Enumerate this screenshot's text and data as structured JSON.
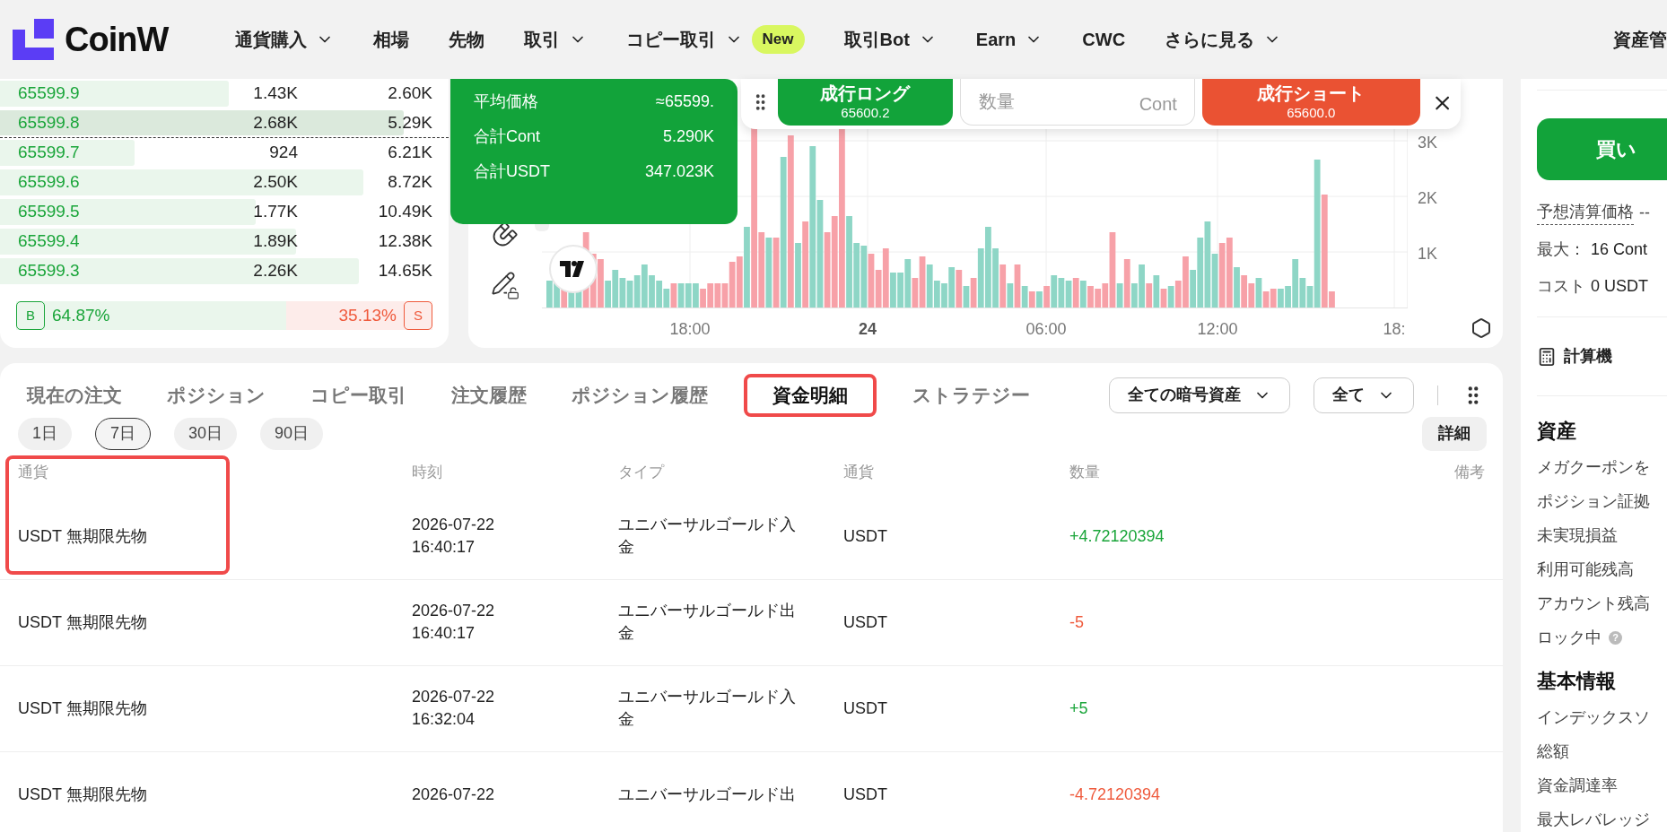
{
  "header": {
    "logo": "CoinW",
    "nav": [
      {
        "label": "通貨購入",
        "dropdown": true
      },
      {
        "label": "相場",
        "dropdown": false
      },
      {
        "label": "先物",
        "dropdown": false
      },
      {
        "label": "取引",
        "dropdown": true
      },
      {
        "label": "コピー取引",
        "dropdown": true,
        "badge": "New"
      },
      {
        "label": "取引Bot",
        "dropdown": true
      },
      {
        "label": "Earn",
        "dropdown": true
      },
      {
        "label": "CWC",
        "dropdown": false
      },
      {
        "label": "さらに見る",
        "dropdown": true
      }
    ],
    "account": "資産管"
  },
  "order_book": {
    "rows": [
      {
        "price": "65599.9",
        "size": "1.43K",
        "total": "2.60K",
        "level": 0.51,
        "selected": false
      },
      {
        "price": "65599.8",
        "size": "2.68K",
        "total": "5.29K",
        "level": 0.9,
        "selected": true
      },
      {
        "price": "65599.7",
        "size": "924",
        "total": "6.21K",
        "level": 0.3,
        "selected": false
      },
      {
        "price": "65599.6",
        "size": "2.50K",
        "total": "8.72K",
        "level": 0.81,
        "selected": false
      },
      {
        "price": "65599.5",
        "size": "1.77K",
        "total": "10.49K",
        "level": 0.57,
        "selected": false
      },
      {
        "price": "65599.4",
        "size": "1.89K",
        "total": "12.38K",
        "level": 0.66,
        "selected": false
      },
      {
        "price": "65599.3",
        "size": "2.26K",
        "total": "14.65K",
        "level": 0.8,
        "selected": false
      }
    ],
    "buy_ratio": {
      "badge": "B",
      "text": "64.87%",
      "level": 0.6487
    },
    "sell_ratio": {
      "badge": "S",
      "text": "35.13%"
    }
  },
  "price_tooltip": {
    "rows": [
      {
        "label": "平均価格",
        "value": "≈65599."
      },
      {
        "label": "合計Cont",
        "value": "5.290K"
      },
      {
        "label": "合計USDT",
        "value": "347.023K"
      }
    ]
  },
  "quick_trade": {
    "long": {
      "label": "成行ロング",
      "price": "65600.2"
    },
    "quantity": {
      "placeholder": "数量",
      "unit": "Cont"
    },
    "short": {
      "label": "成行ショート",
      "price": "65600.0"
    }
  },
  "chart": {
    "y_labels": [
      "3K",
      "2K",
      "1K"
    ],
    "x_labels": [
      {
        "label": "18:00",
        "bold": false
      },
      {
        "label": "24",
        "bold": true
      },
      {
        "label": "06:00",
        "bold": false
      },
      {
        "label": "12:00",
        "bold": false
      },
      {
        "label": "18:",
        "bold": false
      }
    ]
  },
  "bottom": {
    "tabs": [
      {
        "label": "現在の注文",
        "selected": false,
        "annotated": false
      },
      {
        "label": "ポジション",
        "selected": false,
        "annotated": false
      },
      {
        "label": "コピー取引",
        "selected": false,
        "annotated": false
      },
      {
        "label": "注文履歴",
        "selected": false,
        "annotated": false
      },
      {
        "label": "ポジション履歴",
        "selected": false,
        "annotated": false
      },
      {
        "label": "資金明細",
        "selected": true,
        "annotated": true
      },
      {
        "label": "ストラテジー",
        "selected": false,
        "annotated": false
      }
    ],
    "filters": [
      "全ての暗号資産",
      "全て"
    ],
    "periods": [
      {
        "label": "1日",
        "selected": false
      },
      {
        "label": "7日",
        "selected": true
      },
      {
        "label": "30日",
        "selected": false
      },
      {
        "label": "90日",
        "selected": false
      }
    ],
    "detail_button": "詳細",
    "table": {
      "columns": [
        "通貨",
        "時刻",
        "タイプ",
        "通貨",
        "数量",
        "備考"
      ],
      "annotated": true,
      "rows": [
        {
          "account": "USDT 無期限先物",
          "date": "2026-07-22",
          "time": "16:40:17",
          "type": "ユニバーサルゴールド入金",
          "currency": "USDT",
          "amount": "+4.72120394",
          "color": "#1aa53a"
        },
        {
          "account": "USDT 無期限先物",
          "date": "2026-07-22",
          "time": "16:40:17",
          "type": "ユニバーサルゴールド出金",
          "currency": "USDT",
          "amount": "-5",
          "color": "#ef5a3c"
        },
        {
          "account": "USDT 無期限先物",
          "date": "2026-07-22",
          "time": "16:32:04",
          "type": "ユニバーサルゴールド入金",
          "currency": "USDT",
          "amount": "+5",
          "color": "#1aa53a"
        },
        {
          "account": "USDT 無期限先物",
          "date": "2026-07-22",
          "type": "ユニバーサルゴールド出",
          "currency": "USDT",
          "amount": "-4.72120394",
          "color": "#ef5a3c"
        }
      ]
    }
  },
  "side": {
    "buy_button": "買い",
    "liquidation": {
      "label": "予想清算価格",
      "value": "--"
    },
    "max": {
      "label": "最大：",
      "value": "16 Cont"
    },
    "cost": {
      "label": "コスト",
      "value": "0 USDT"
    },
    "calculator": "計算機",
    "assets": {
      "title": "資産",
      "items": [
        {
          "label": "メガクーポンを"
        },
        {
          "label": "ポジション証拠"
        },
        {
          "label": "未実現損益"
        },
        {
          "label": "利用可能残高"
        },
        {
          "label": "アカウント残高"
        },
        {
          "label": "ロック中",
          "help_icon": "?"
        }
      ]
    },
    "basic_info": {
      "title": "基本情報",
      "items": [
        "インデックスソ",
        "総額",
        "資金調達率",
        "最大レバレッジ"
      ]
    }
  }
}
